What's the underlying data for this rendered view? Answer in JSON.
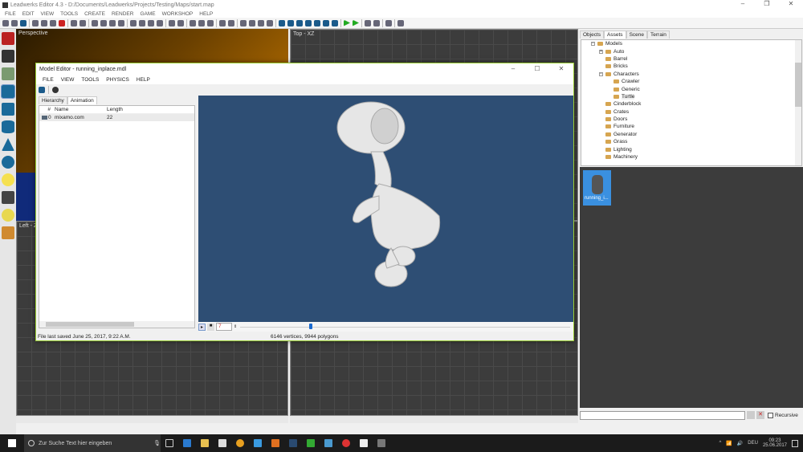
{
  "app": {
    "title": "Leadwerks Editor 4.3 - D:/Documents/Leadwerks/Projects/Testing/Maps/start.map",
    "menu": [
      "FILE",
      "EDIT",
      "VIEW",
      "TOOLS",
      "CREATE",
      "RENDER",
      "GAME",
      "WORKSHOP",
      "HELP"
    ]
  },
  "viewports": {
    "perspective": "Perspective",
    "top": "Top - XZ",
    "left": "Left - Z"
  },
  "right_panel": {
    "tabs": [
      "Objects",
      "Assets",
      "Scene",
      "Terrain"
    ],
    "active_tab": "Assets",
    "tree": [
      {
        "label": "Models",
        "level": 0,
        "expander": "−"
      },
      {
        "label": "Auto",
        "level": 1,
        "expander": "+"
      },
      {
        "label": "Barrel",
        "level": 1
      },
      {
        "label": "Bricks",
        "level": 1
      },
      {
        "label": "Characters",
        "level": 1,
        "expander": "−"
      },
      {
        "label": "Crawler",
        "level": 2
      },
      {
        "label": "Generic",
        "level": 2
      },
      {
        "label": "Turtle",
        "level": 2,
        "selected": true
      },
      {
        "label": "Cinderblock",
        "level": 1
      },
      {
        "label": "Crates",
        "level": 1
      },
      {
        "label": "Doors",
        "level": 1
      },
      {
        "label": "Furniture",
        "level": 1
      },
      {
        "label": "Generator",
        "level": 1
      },
      {
        "label": "Grass",
        "level": 1
      },
      {
        "label": "Lighting",
        "level": 1
      },
      {
        "label": "Machinery",
        "level": 1
      }
    ],
    "thumbnail_label": "running_i...",
    "recursive_label": "Recursive"
  },
  "model_editor": {
    "title": "Model Editor - running_inplace.mdl",
    "menu": [
      "FILE",
      "VIEW",
      "TOOLS",
      "PHYSICS",
      "HELP"
    ],
    "tabs": [
      "Hierarchy",
      "Animation"
    ],
    "active_tab": "Animation",
    "columns": [
      "#",
      "Name",
      "Length"
    ],
    "rows": [
      {
        "index": "0",
        "name": "mixamo.com",
        "length": "22"
      }
    ],
    "frame": "7",
    "timeline_position": 0.21,
    "status_left": "File last saved June 25, 2017, 9:22 A.M.",
    "status_center": "6146 vertices, 9944 polygons"
  },
  "taskbar": {
    "search_placeholder": "Zur Suche Text hier eingeben",
    "lang": "DEU",
    "time": "09:23",
    "date": "25.06.2017"
  },
  "colors": {
    "viewport_bg": "#2e4e74",
    "accent": "#3a90e0"
  }
}
